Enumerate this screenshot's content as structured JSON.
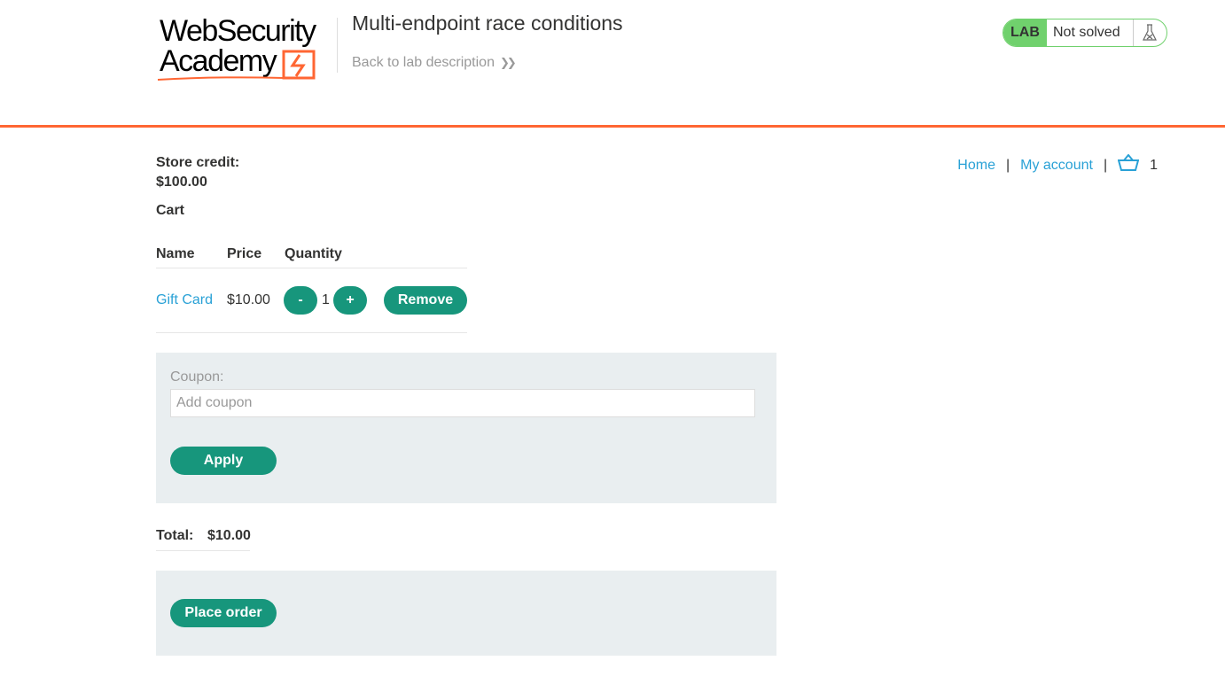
{
  "header": {
    "logo": {
      "line1": "WebSecurity",
      "line2": "Academy"
    },
    "lab_title": "Multi-endpoint race conditions",
    "back_link": "Back to lab description",
    "lab_badge": "LAB",
    "lab_status": "Not solved",
    "icons": {
      "flask": "flask-icon",
      "chevrons": "double-chevron-right-icon"
    }
  },
  "nav": {
    "home": "Home",
    "separator": "|",
    "my_account": "My account",
    "cart_count": "1",
    "cart_icon": "basket-icon"
  },
  "store_credit": {
    "label": "Store credit:",
    "value": "$100.00"
  },
  "cart": {
    "heading": "Cart",
    "columns": [
      "Name",
      "Price",
      "Quantity"
    ],
    "items": [
      {
        "name": "Gift Card",
        "price": "$10.00",
        "quantity": "1",
        "decrement": "-",
        "increment": "+",
        "remove": "Remove"
      }
    ]
  },
  "coupon": {
    "label": "Coupon:",
    "placeholder": "Add coupon",
    "apply": "Apply"
  },
  "total": {
    "label": "Total:",
    "value": "$10.00"
  },
  "order": {
    "place_order": "Place order"
  },
  "colors": {
    "accent_orange": "#ff6633",
    "button_green": "#17967c",
    "link_blue": "#29a1d6",
    "lab_green": "#70d16d",
    "panel_bg": "#e9eef0"
  }
}
